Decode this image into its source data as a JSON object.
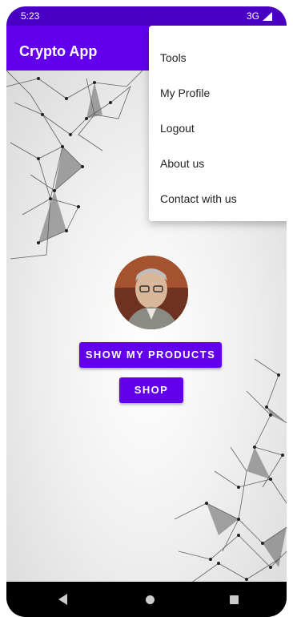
{
  "status": {
    "time": "5:23",
    "network": "3G"
  },
  "app_bar": {
    "title": "Crypto App"
  },
  "menu": {
    "items": [
      {
        "label": "Tools"
      },
      {
        "label": "My Profile"
      },
      {
        "label": "Logout"
      },
      {
        "label": "About us"
      },
      {
        "label": "Contact with us"
      }
    ]
  },
  "main": {
    "show_products_label": "SHOW MY PRODUCTS",
    "shop_label": "SHOP"
  },
  "colors": {
    "primary": "#6200ee",
    "status_bar": "#4a00c4"
  },
  "icons": {
    "nav_back": "back-triangle",
    "nav_home": "home-circle",
    "nav_recent": "recent-square"
  }
}
